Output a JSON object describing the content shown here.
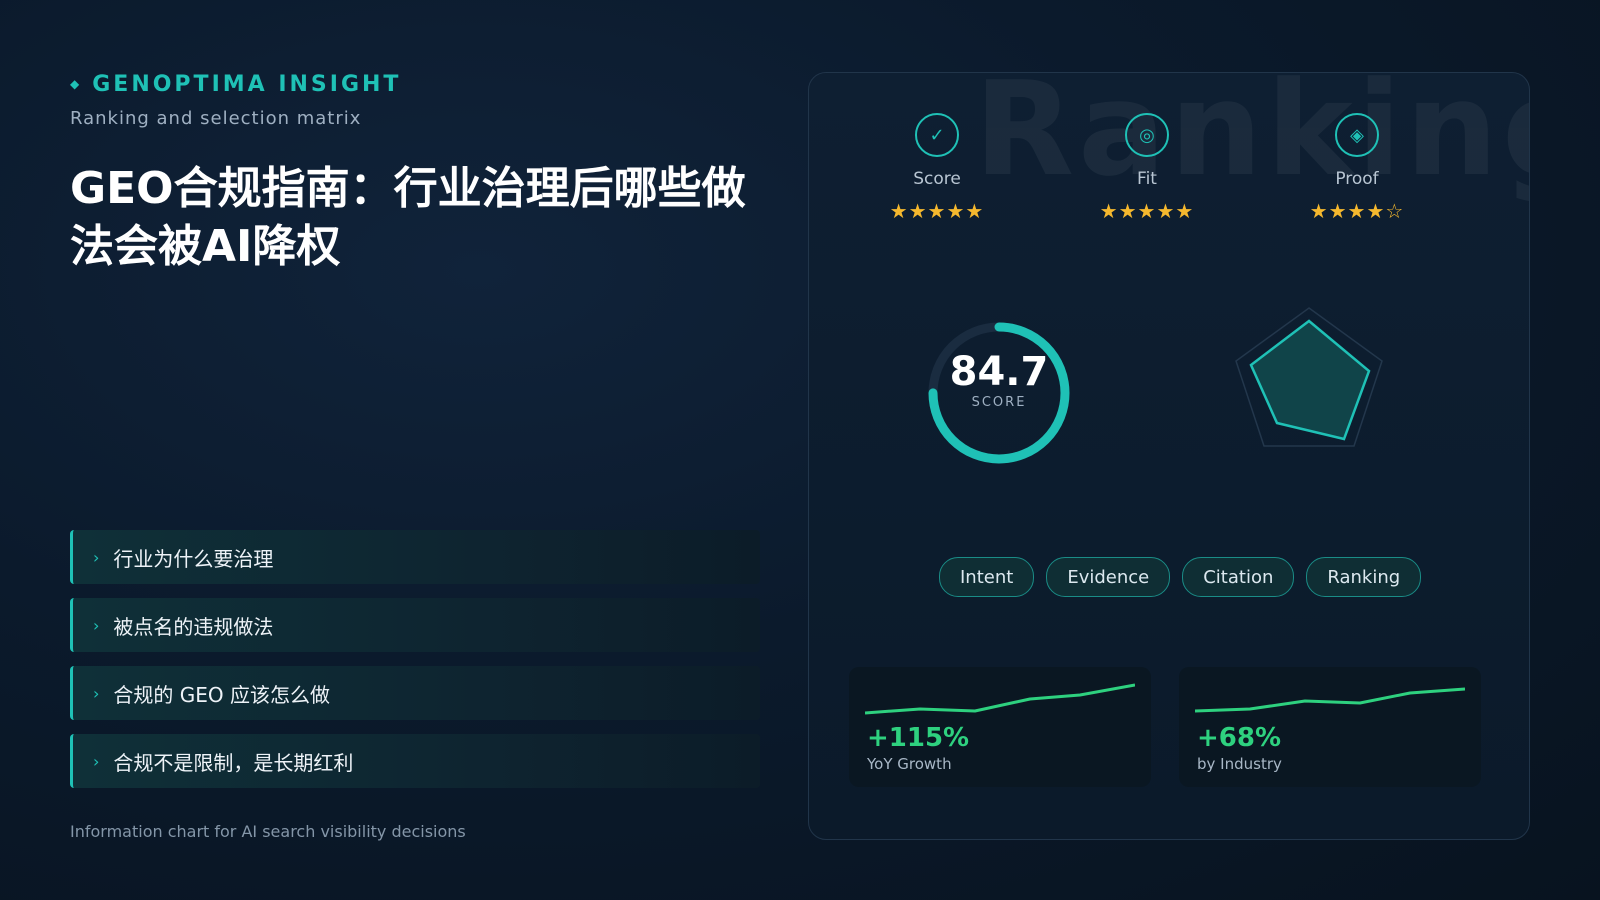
{
  "brand": {
    "name": "GENOPTIMA INSIGHT",
    "subtitle": "Ranking and selection matrix"
  },
  "title": "GEO合规指南：行业治理后哪些做法会被AI降权",
  "list_items": [
    {
      "label": "行业为什么要治理"
    },
    {
      "label": "被点名的违规做法"
    },
    {
      "label": "合规的 GEO 应该怎么做"
    },
    {
      "label": "合规不是限制，是长期红利"
    }
  ],
  "footnote": "Information chart for AI search visibility decisions",
  "panel": {
    "watermark": "Ranking",
    "metrics": [
      {
        "label": "Score",
        "icon": "check-icon",
        "stars": "★★★★★",
        "rating": 5
      },
      {
        "label": "Fit",
        "icon": "target-icon",
        "stars": "★★★★★",
        "rating": 5
      },
      {
        "label": "Proof",
        "icon": "diamond-icon",
        "stars": "★★★★☆",
        "rating": 4
      }
    ],
    "gauge": {
      "value": "84.7",
      "caption": "SCORE",
      "fraction": 0.75
    },
    "tags": [
      "Intent",
      "Evidence",
      "Citation",
      "Ranking"
    ],
    "mini_cards": [
      {
        "value": "+115%",
        "label": "YoY Growth"
      },
      {
        "value": "+68%",
        "label": "by Industry"
      }
    ]
  },
  "colors": {
    "accent": "#1fc1b6",
    "star": "#f5b82e",
    "positive": "#2ed17f",
    "background": "#0b1a2c"
  }
}
